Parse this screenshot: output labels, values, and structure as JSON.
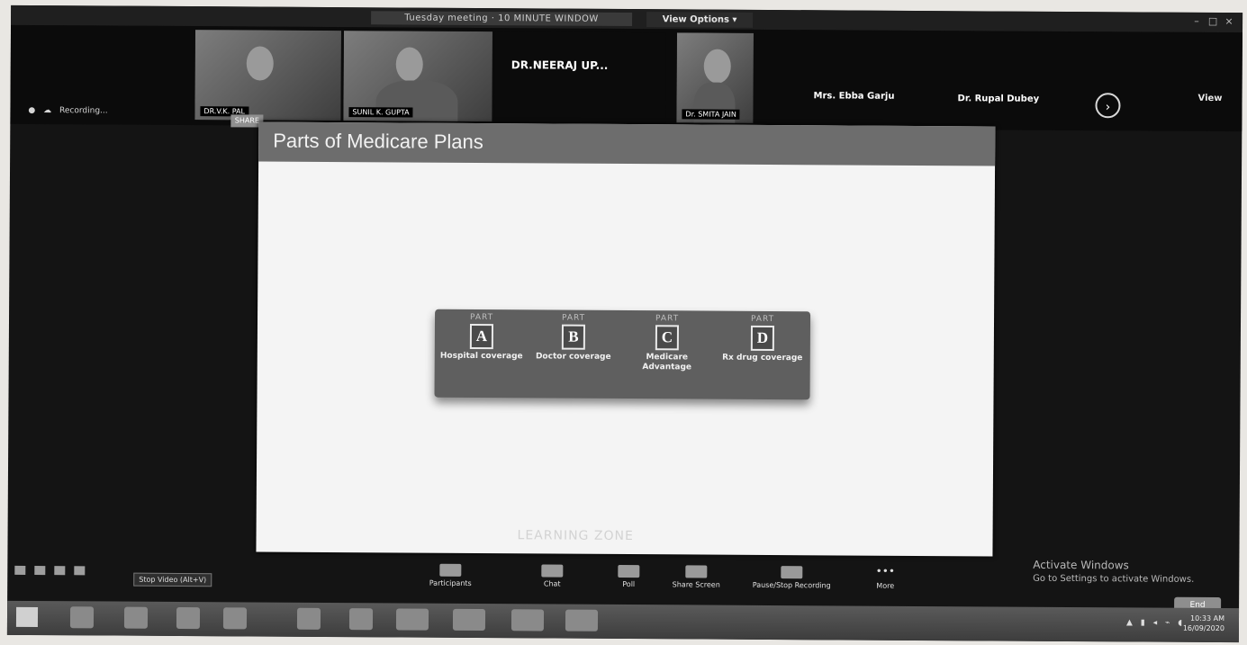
{
  "window": {
    "title": "Tuesday meeting · 10 MINUTE WINDOW",
    "view_options": "View Options ▾"
  },
  "gallery": {
    "participants": [
      {
        "name": "DR.V.K. PAL"
      },
      {
        "name": "SUNIL K. GUPTA"
      },
      {
        "name": "DR.NEERAJ UP..."
      },
      {
        "name": "Dr. SMITA JAIN"
      },
      {
        "name": "Mrs. Ebba Garju"
      },
      {
        "name": "Dr. Rupal Dubey"
      }
    ],
    "next_icon": "chevron-right-icon",
    "view_label": "View"
  },
  "left_toolbar": {
    "labels": [
      "●",
      "☁",
      "Recording..."
    ],
    "share_label": "SHARE"
  },
  "slide": {
    "title": "Parts of Medicare Plans",
    "parts": [
      {
        "label": "PART",
        "letter": "A",
        "desc": "Hospital coverage"
      },
      {
        "label": "PART",
        "letter": "B",
        "desc": "Doctor coverage"
      },
      {
        "label": "PART",
        "letter": "C",
        "desc": "Medicare Advantage"
      },
      {
        "label": "PART",
        "letter": "D",
        "desc": "Rx drug coverage"
      }
    ],
    "watermark": "LEARNING ZONE"
  },
  "windows_notice": {
    "line1": "Activate Windows",
    "line2": "Go to Settings to activate Windows."
  },
  "controls": {
    "items": [
      {
        "name": "participants",
        "label": "Participants",
        "icon": "people-icon"
      },
      {
        "name": "chat",
        "label": "Chat",
        "icon": "chat-icon"
      },
      {
        "name": "poll",
        "label": "Poll",
        "icon": "poll-icon"
      },
      {
        "name": "share-screen",
        "label": "Share Screen",
        "icon": "share-screen-icon"
      },
      {
        "name": "pause-stop-recording",
        "label": "Pause/Stop Recording",
        "icon": "record-icon"
      },
      {
        "name": "more",
        "label": "More",
        "icon": "more-icon"
      }
    ],
    "tooltip": "Stop Video (Alt+V)",
    "end_label": "End"
  },
  "taskbar": {
    "clock_time": "10:33 AM",
    "clock_date": "16/09/2020"
  }
}
